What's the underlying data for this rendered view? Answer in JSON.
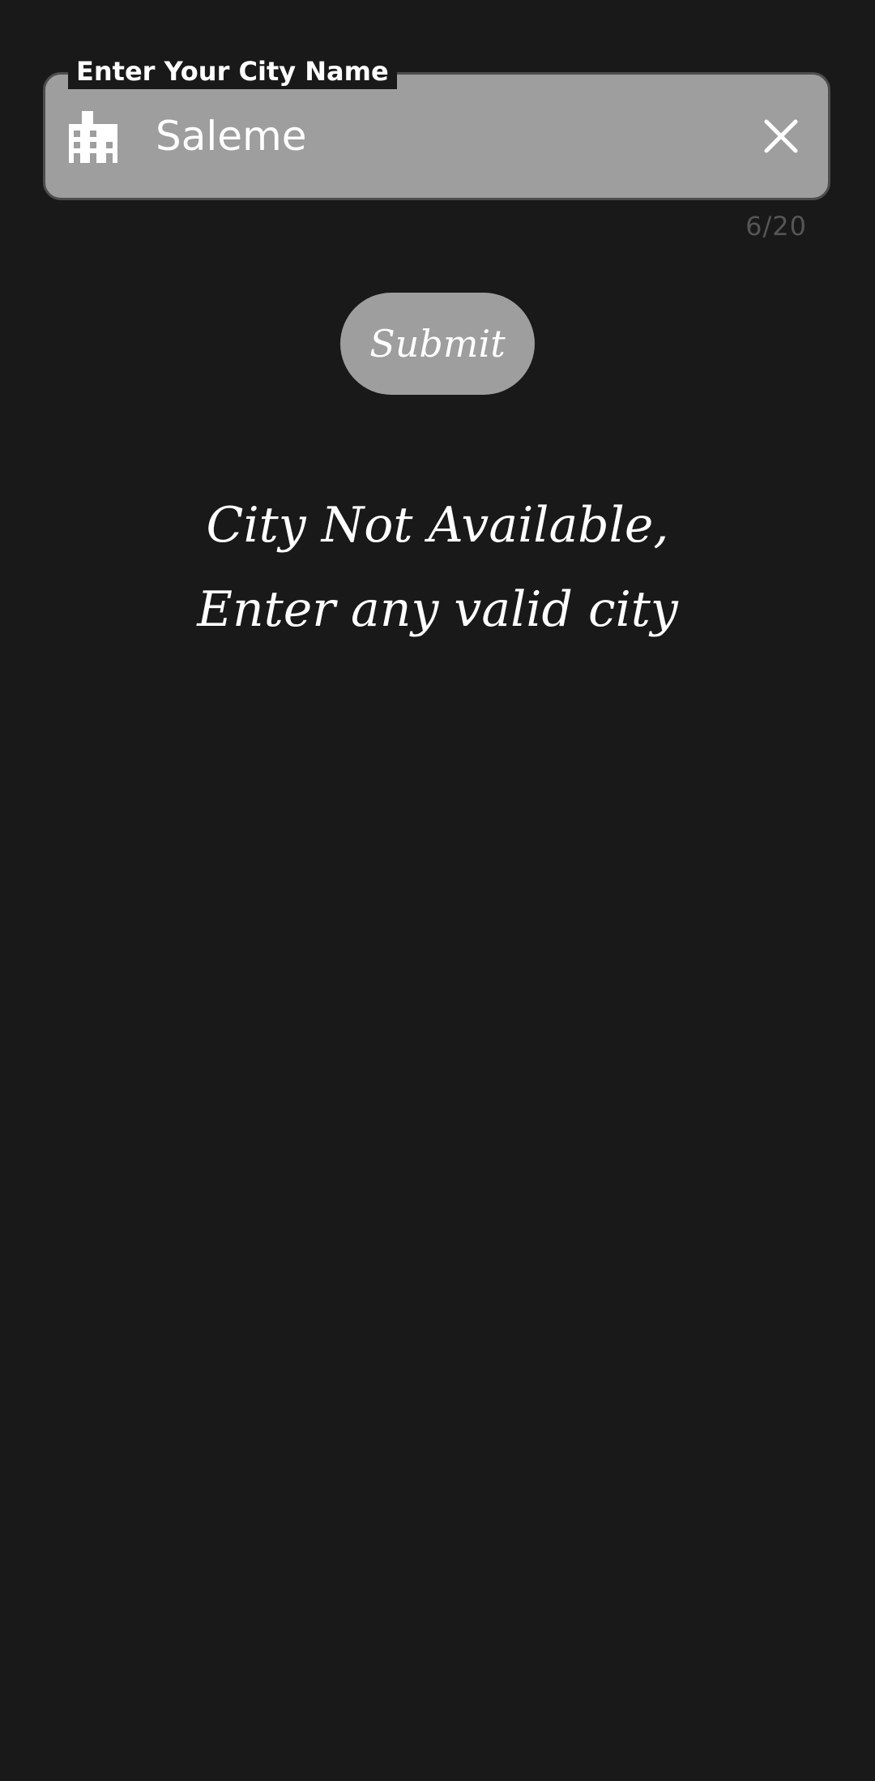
{
  "city_field": {
    "label": "Enter Your City Name",
    "value": "Saleme",
    "counter": "6/20",
    "leading_icon": "city-buildings-icon",
    "trailing_icon": "close-icon"
  },
  "submit_button": {
    "label": "Submit"
  },
  "error_message": {
    "line1": "City Not Available,",
    "line2": "Enter any valid city"
  },
  "colors": {
    "background": "#191919",
    "field_fill": "#9e9e9e",
    "field_border": "#4d4d4d",
    "text": "#ffffff",
    "counter_text": "#555555"
  }
}
